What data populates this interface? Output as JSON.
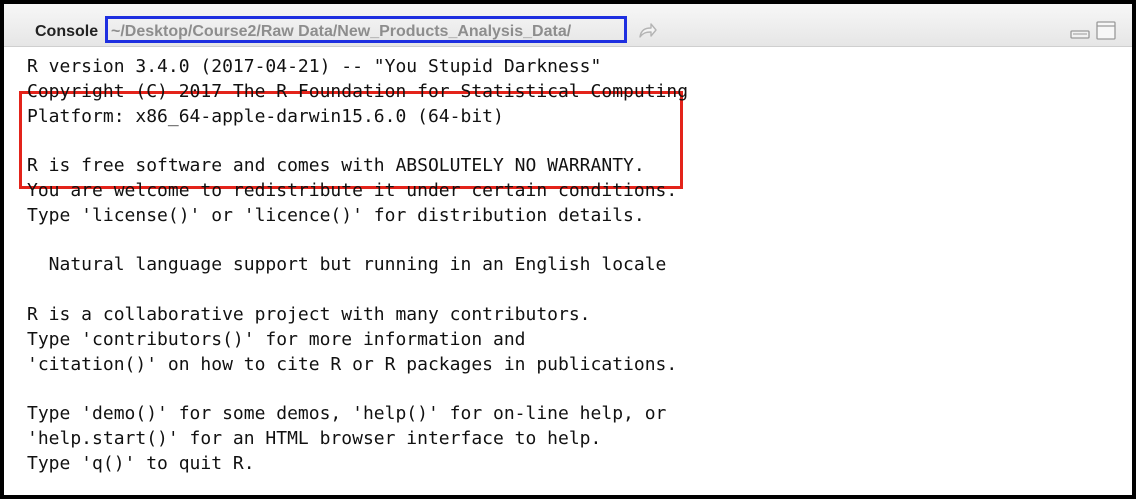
{
  "header": {
    "title": "Console",
    "working_directory": "~/Desktop/Course2/Raw Data/New_Products_Analysis_Data/"
  },
  "icons": {
    "goto_directory": "go-to-directory-icon",
    "minimize": "minimize-icon",
    "maximize": "maximize-icon"
  },
  "colors": {
    "path_highlight": "#1e2fe0",
    "version_highlight": "#e3231a"
  },
  "console": {
    "lines": [
      "R version 3.4.0 (2017-04-21) -- \"You Stupid Darkness\"",
      "Copyright (C) 2017 The R Foundation for Statistical Computing",
      "Platform: x86_64-apple-darwin15.6.0 (64-bit)",
      "",
      "R is free software and comes with ABSOLUTELY NO WARRANTY.",
      "You are welcome to redistribute it under certain conditions.",
      "Type 'license()' or 'licence()' for distribution details.",
      "",
      "  Natural language support but running in an English locale",
      "",
      "R is a collaborative project with many contributors.",
      "Type 'contributors()' for more information and",
      "'citation()' on how to cite R or R packages in publications.",
      "",
      "Type 'demo()' for some demos, 'help()' for on-line help, or",
      "'help.start()' for an HTML browser interface to help.",
      "Type 'q()' to quit R."
    ]
  }
}
